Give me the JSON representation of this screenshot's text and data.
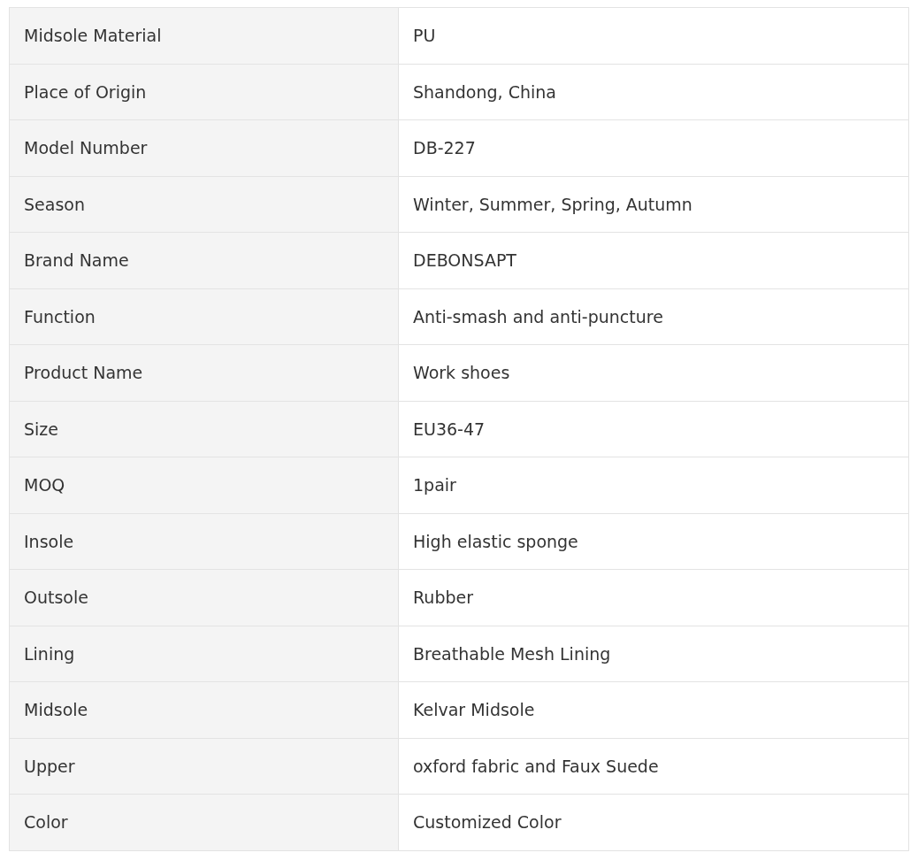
{
  "table": {
    "rows": [
      {
        "label": "Midsole Material",
        "value": "PU"
      },
      {
        "label": "Place of Origin",
        "value": "Shandong, China"
      },
      {
        "label": "Model Number",
        "value": "DB-227"
      },
      {
        "label": "Season",
        "value": "Winter, Summer, Spring, Autumn"
      },
      {
        "label": "Brand Name",
        "value": "DEBONSAPT"
      },
      {
        "label": "Function",
        "value": "Anti-smash and anti-puncture"
      },
      {
        "label": "Product Name",
        "value": "Work shoes"
      },
      {
        "label": "Size",
        "value": "EU36-47"
      },
      {
        "label": "MOQ",
        "value": "1pair"
      },
      {
        "label": "Insole",
        "value": "High elastic sponge"
      },
      {
        "label": "Outsole",
        "value": "Rubber"
      },
      {
        "label": "Lining",
        "value": "Breathable Mesh Lining"
      },
      {
        "label": "Midsole",
        "value": "Kelvar Midsole"
      },
      {
        "label": "Upper",
        "value": "oxford fabric and Faux Suede"
      },
      {
        "label": "Color",
        "value": "Customized Color"
      }
    ]
  }
}
